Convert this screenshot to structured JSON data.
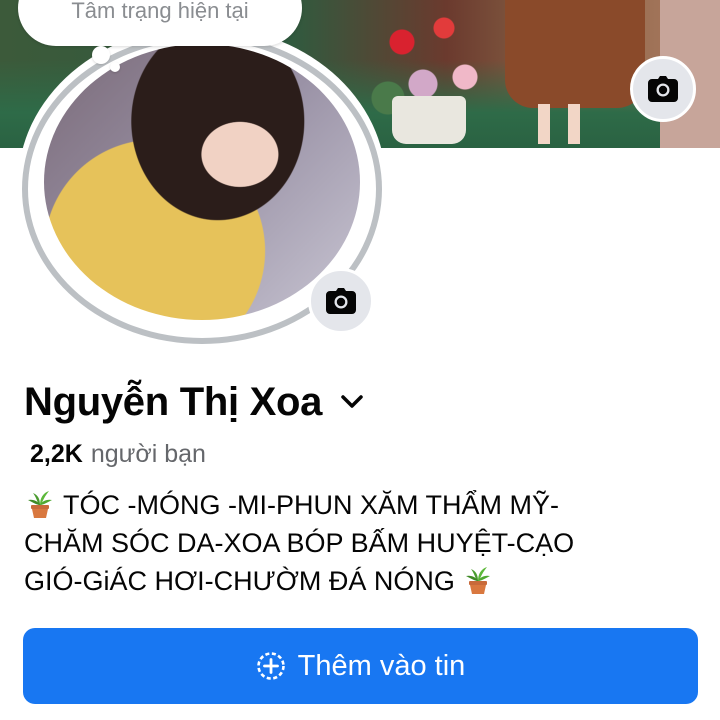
{
  "bubble": {
    "text": "Tâm trạng hiện tại"
  },
  "profile": {
    "name": "Nguyễn Thị Xoa",
    "friends_count": "2,2K",
    "friends_label": "người bạn",
    "bio_lines": [
      "TÓC -MÓNG -MI-PHUN XĂM THẨM MỸ-",
      "CHĂM SÓC DA-XOA BÓP BẤM HUYỆT-CẠO",
      "GIÓ-GiÁC HƠI-CHƯỜM ĐÁ NÓNG"
    ]
  },
  "actions": {
    "add_story_label": "Thêm vào tin"
  },
  "icons": {
    "cover_camera": "camera-icon",
    "avatar_camera": "camera-icon",
    "name_dropdown": "chevron-down-icon",
    "story_add": "plus-circle-icon",
    "bio_emoji": "potted-plant-icon"
  },
  "colors": {
    "primary": "#1877f2",
    "text": "#050505",
    "secondary_text": "#65676b",
    "icon_bg": "#e4e6eb"
  }
}
